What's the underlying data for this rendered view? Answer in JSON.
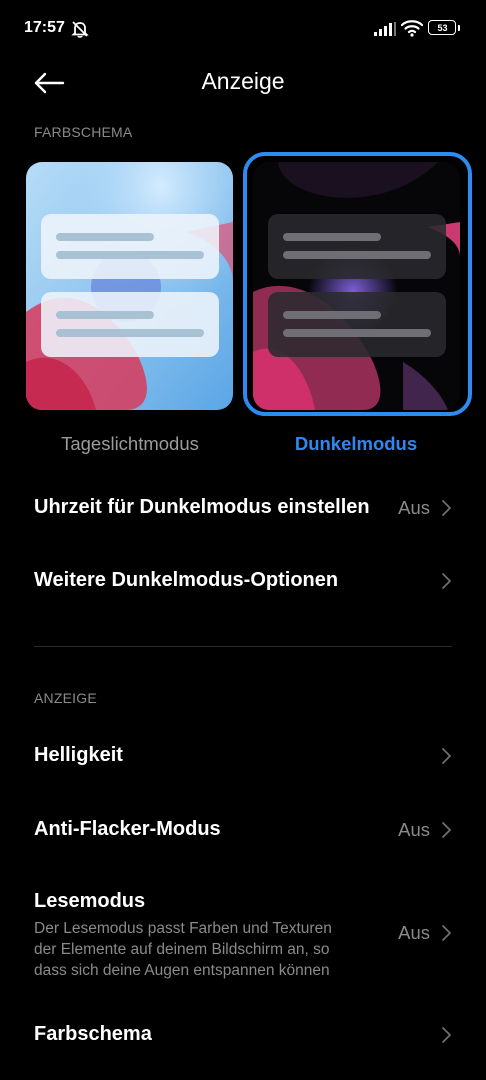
{
  "status_bar": {
    "time": "17:57",
    "battery": "53"
  },
  "header": {
    "title": "Anzeige"
  },
  "color_scheme_section": {
    "label": "FARBSCHEMA",
    "light_mode_label": "Tageslichtmodus",
    "dark_mode_label": "Dunkelmodus",
    "selected": "Dunkelmodus",
    "accent_color": "#2d8cf2"
  },
  "dark_schedule": {
    "title": "Uhrzeit für Dunkelmodus einstellen",
    "value": "Aus"
  },
  "dark_options": {
    "title": "Weitere Dunkelmodus-Optionen"
  },
  "display_section": {
    "label": "ANZEIGE"
  },
  "brightness": {
    "title": "Helligkeit"
  },
  "anti_flicker": {
    "title": "Anti-Flacker-Modus",
    "value": "Aus"
  },
  "reading_mode": {
    "title": "Lesemodus",
    "desc_lines": [
      "Der Lesemodus passt Farben und Texturen",
      "der Elemente auf deinem Bildschirm an, so",
      "dass sich deine Augen entspannen können"
    ],
    "value": "Aus"
  },
  "color_scheme_row": {
    "title": "Farbschema"
  }
}
